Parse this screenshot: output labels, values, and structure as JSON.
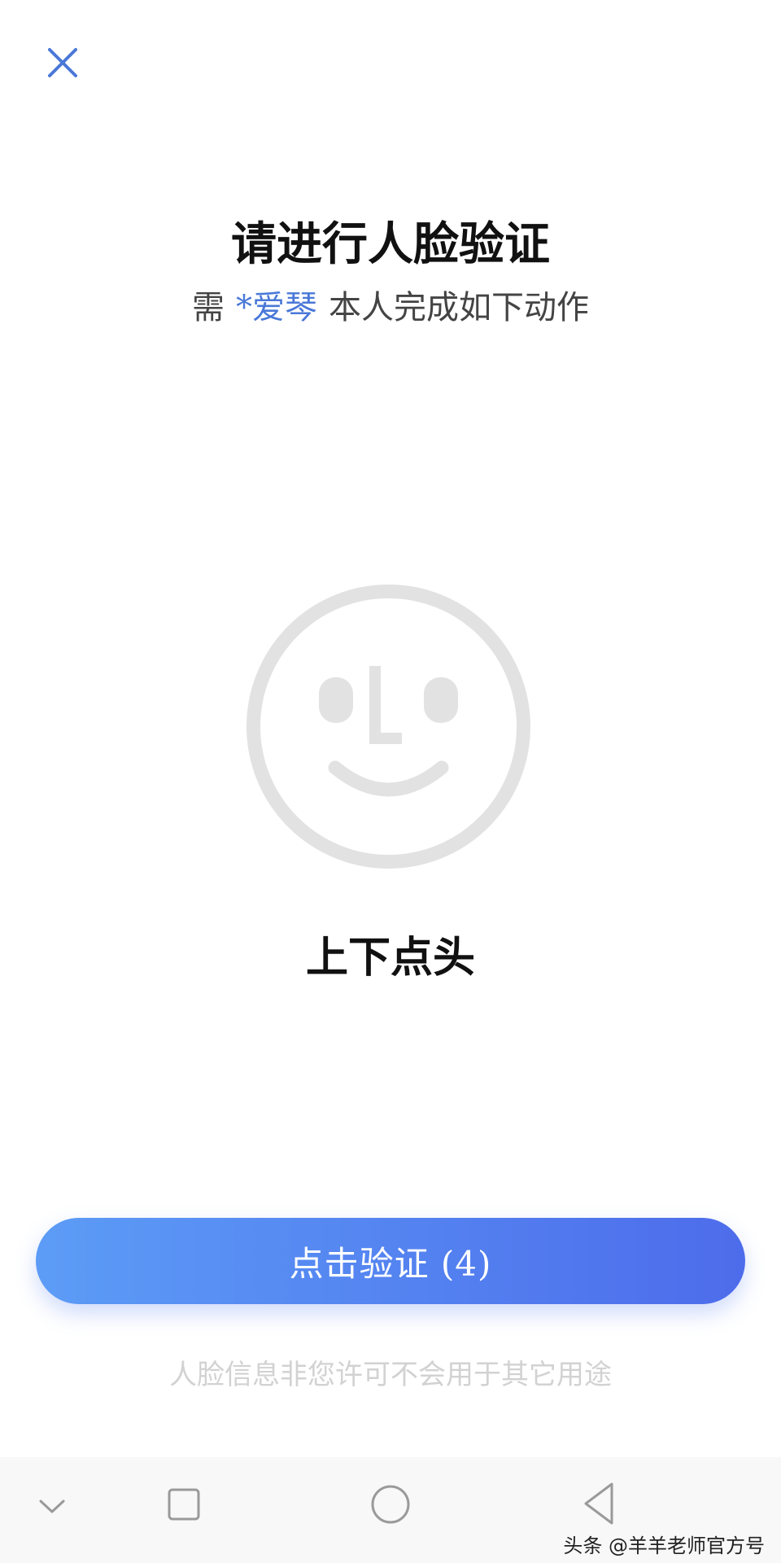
{
  "header": {
    "close_icon": "close-icon"
  },
  "main": {
    "title": "请进行人脸验证",
    "subtitle": {
      "prefix": "需",
      "name": "*爱琴",
      "suffix": "本人完成如下动作"
    },
    "face_icon": "face-outline-icon",
    "action": "上下点头"
  },
  "verify_button": {
    "label": "点击验证 (4)"
  },
  "privacy_note": "人脸信息非您许可不会用于其它用途",
  "nav_bar": {
    "buttons": [
      "chevron-down-icon",
      "square-icon",
      "circle-icon",
      "triangle-back-icon"
    ]
  },
  "watermark": "头条 @羊羊老师官方号",
  "colors": {
    "accent": "#4a78d8",
    "button_gradient_start": "#5c9cf6",
    "button_gradient_end": "#4d6ceb",
    "face_gray": "#e2e2e2",
    "note_gray": "#d2d2d2"
  }
}
